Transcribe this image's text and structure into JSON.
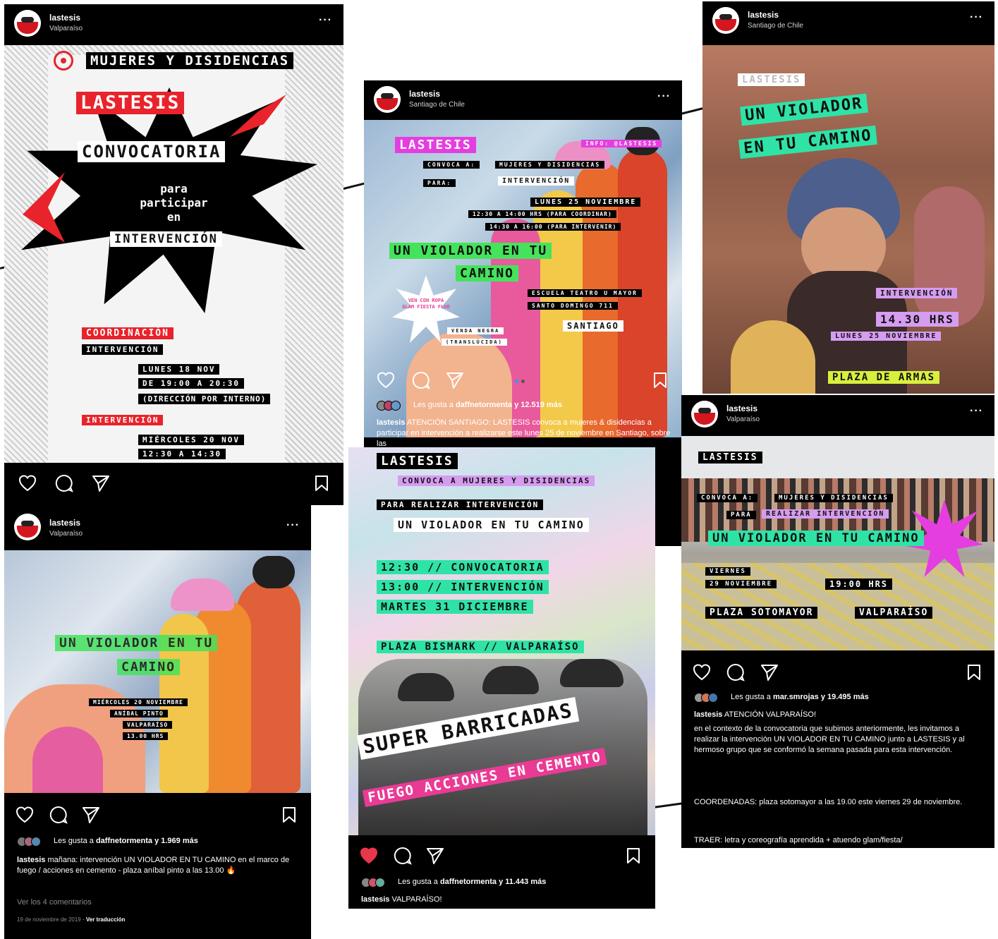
{
  "connector_lines": [
    "line-a",
    "line-b",
    "line-c",
    "line-d"
  ],
  "icons": {
    "like": "heart-icon",
    "comment": "comment-bubble-icon",
    "share": "paper-plane-icon",
    "save": "bookmark-icon",
    "more": "ellipsis-icon"
  },
  "colors": {
    "liked_heart": "#e8364a",
    "poster_red": "#e8232b",
    "poster_green": "#2fe3a6",
    "poster_pink": "#e93b94"
  },
  "posts": {
    "p1": {
      "username": "lastesis",
      "location": "Valparaíso",
      "more": "···",
      "poster": {
        "l1": "MUJERES Y DISIDENCIAS",
        "l2": "LASTESIS",
        "l3": "CONVOCATORIA",
        "l4": "para",
        "l5": "participar",
        "l6": "en",
        "l7": "INTERVENCIÓN",
        "l8": "COORDINACIÓN",
        "l9": "INTERVENCIÓN",
        "l10": "LUNES 18 NOV",
        "l11": "DE 19:00 A 20:30",
        "l12": "(DIRECCIÓN POR INTERNO)",
        "l13": "INTERVENCIÓN",
        "l14": "MIÉRCOLES 20 NOV",
        "l15": "12:30 A 14:30"
      }
    },
    "p2": {
      "username": "lastesis",
      "location": "Santiago de Chile",
      "more": "···",
      "poster": {
        "l1": "LASTESIS",
        "l2": "INFO: @LASTESIS",
        "l3": "CONVOCA A:",
        "l4": "MUJERES Y DISIDENCIAS",
        "l5": "PARA:",
        "l6": "INTERVENCIÓN",
        "l7": "LUNES 25 NOVIEMBRE",
        "l8": "12:30 A 14:00 HRS (PARA COORDINAR)",
        "l9": "14:30 A 16:00 (PARA INTERVENIR)",
        "l10": "UN VIOLADOR EN TU",
        "l11": "CAMINO",
        "l12": "ESCUELA TEATRO U MAYOR",
        "l13": "SANTO DOMINGO 711",
        "l14": "SANTIAGO",
        "l15": "VEN CON ROPA GLAM FIESTA FLUO",
        "l16": "VENDA NEGRA",
        "l17": "(TRANSLÚCIDA)"
      },
      "likes_prefix": "Les gusta a",
      "likes_user": "daffnetormenta",
      "likes_suffix": "y 12.519 más",
      "caption_user": "lastesis",
      "caption_text": "ATENCIÓN SANTIAGO: LASTESIS convoca a mujeres & disidencias a participar en intervención a realizarse este lunes 25 de noviembre en Santiago, sobre las"
    },
    "p3": {
      "username": "lastesis",
      "location": "Santiago de Chile",
      "more": "···",
      "poster": {
        "l1": "LASTESIS",
        "l2": "UN VIOLADOR",
        "l3": "EN TU CAMINO",
        "l4": "INTERVENCIÓN",
        "l5": "14.30 HRS",
        "l6": "LUNES 25 NOVIEMBRE",
        "l7": "PLAZA DE ARMAS"
      }
    },
    "p4": {
      "username": "lastesis",
      "location": "Valparaíso",
      "more": "···",
      "poster": {
        "l1": "UN VIOLADOR EN TU",
        "l2": "CAMINO",
        "l3": "MIÉRCOLES 20 NOVIEMBRE",
        "l4": "ANÍBAL PINTO",
        "l5": "VALPARAÍSO",
        "l6": "13.00 HRS"
      },
      "likes_prefix": "Les gusta a",
      "likes_user": "daffnetormenta",
      "likes_suffix": "y 1.969 más",
      "caption_user": "lastesis",
      "caption_text": "mañana: intervención UN VIOLADOR EN TU CAMINO en el marco de fuego / acciones en cemento - plaza aníbal pinto a las 13.00 🔥",
      "comments_link": "Ver los 4 comentarios",
      "date": "19 de noviembre de 2019",
      "translate": "Ver traducción"
    },
    "p5": {
      "poster": {
        "l1": "LASTESIS",
        "l2": "CONVOCA A MUJERES Y DISIDENCIAS",
        "l3": "PARA REALIZAR INTERVENCIÓN",
        "l4": "UN VIOLADOR EN TU CAMINO",
        "l5": "12:30 // CONVOCATORIA",
        "l6": "13:00 // INTERVENCIÓN",
        "l7": "MARTES 31 DICIEMBRE",
        "l8": "PLAZA BISMARK // VALPARAÍSO",
        "l9": "SUPER BARRICADAS",
        "l10": "FUEGO ACCIONES EN CEMENTO"
      },
      "likes_prefix": "Les gusta a",
      "likes_user": "daffnetormenta",
      "likes_suffix": "y 11.443 más",
      "caption_user": "lastesis",
      "caption_text": "VALPARAÍSO!"
    },
    "p6": {
      "username": "lastesis",
      "location": "Valparaíso",
      "more": "···",
      "poster": {
        "l1": "LASTESIS",
        "l2": "CONVOCA A:",
        "l3": "MUJERES Y DISIDENCIAS",
        "l4": "PARA",
        "l5": "REALIZAR INTERVENCIÓN",
        "l6": "UN VIOLADOR EN TU CAMINO",
        "l7": "VIERNES",
        "l8": "29 NOVIEMBRE",
        "l9": "19:00 HRS",
        "l10": "PLAZA SOTOMAYOR",
        "l11": "VALPARAÍSO"
      },
      "likes_prefix": "Les gusta a",
      "likes_user": "mar.smrojas",
      "likes_suffix": "y 19.495 más",
      "caption_user": "lastesis",
      "caption_text": "ATENCIÓN VALPARAÍSO!",
      "body1": "en el contexto de la convocatoria que subimos anteriormente, les invitamos a realizar la intervención UN VIOLADOR EN TU CAMINO junto a LASTESIS y al hermoso grupo que se conformó la semana pasada para esta intervención.",
      "body2": "COORDENADAS: plaza sotomayor a las 19.00 este viernes 29 de noviembre.",
      "body3": "TRAER: letra y coreografía aprendida + atuendo glam/fiesta/"
    }
  }
}
